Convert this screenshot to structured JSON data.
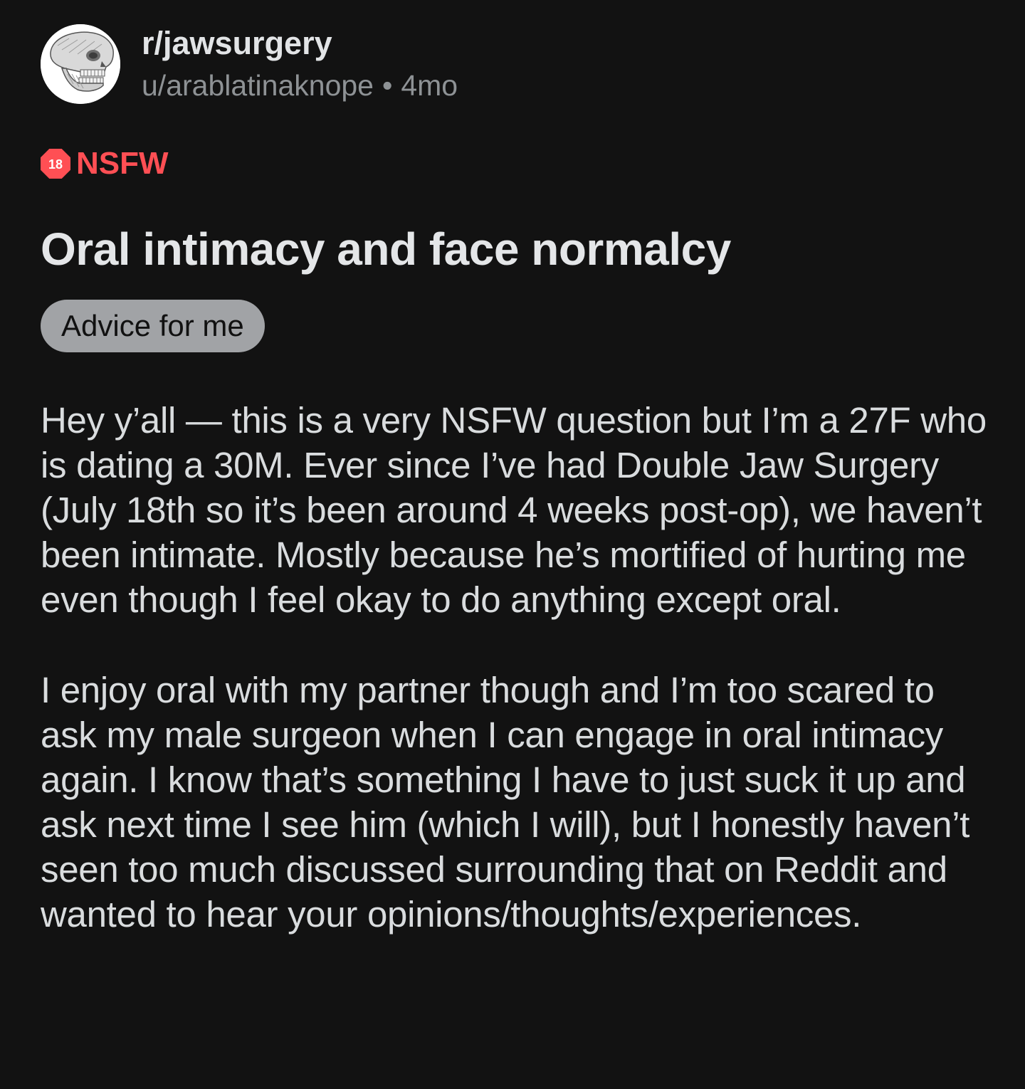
{
  "header": {
    "subreddit": "r/jawsurgery",
    "author": "u/arablatinaknope",
    "separator": "•",
    "age": "4mo",
    "avatar_icon": "skull-jaw-icon"
  },
  "nsfw": {
    "badge_number": "18",
    "label": "NSFW",
    "color": "#ff4f54",
    "icon": "nsfw-18-icon"
  },
  "post": {
    "title": "Oral intimacy and face normalcy",
    "flair": "Advice for me",
    "paragraphs": [
      "Hey y’all — this is a very NSFW question but I’m a 27F who is dating a 30M. Ever since I’ve had Double Jaw Surgery (July 18th so it’s been around 4 weeks post-op), we haven’t been intimate. Mostly because he’s mortified of hurting me even though I feel okay to do anything except oral.",
      "I enjoy oral with my partner though and I’m too scared to ask my male surgeon when I can engage in oral intimacy again. I know that’s something I have to just suck it up and ask next time I see him (which I will), but I honestly haven’t seen too much discussed surrounding that on Reddit and wanted to hear your opinions/thoughts/experiences."
    ]
  },
  "colors": {
    "background": "#121212",
    "text": "#d7dadc",
    "muted": "#8e9295",
    "flair_bg": "#a1a3a6"
  }
}
